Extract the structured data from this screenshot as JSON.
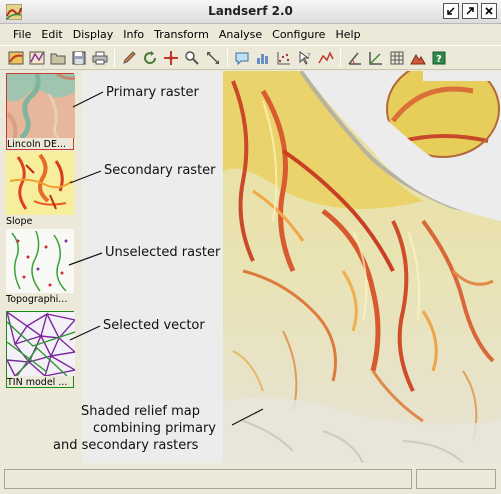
{
  "window": {
    "title": "Landserf 2.0",
    "controls": [
      "minimize",
      "maximize",
      "close"
    ]
  },
  "menu": {
    "items": [
      "File",
      "Edit",
      "Display",
      "Info",
      "Transform",
      "Analyse",
      "Configure",
      "Help"
    ]
  },
  "toolbar": {
    "groups": [
      [
        "raster-icon",
        "vector-icon",
        "open-folder-icon",
        "save-icon",
        "print-icon"
      ],
      [
        "pencil-icon",
        "refresh-icon",
        "crosshair-icon",
        "zoom-icon",
        "pan-icon"
      ],
      [
        "info-bubble-icon",
        "histogram-icon",
        "scatter-icon",
        "query-icon",
        "profile-icon"
      ],
      [
        "angle-icon",
        "axes-icon",
        "grid-icon",
        "terrain-icon",
        "help-icon"
      ]
    ]
  },
  "thumbnails": [
    {
      "label": "Lincoln DE...",
      "kind": "primary"
    },
    {
      "label": "Slope",
      "kind": "secondary"
    },
    {
      "label": "Topographi...",
      "kind": "unselected"
    },
    {
      "label": "TIN model ...",
      "kind": "vector"
    }
  ],
  "annotations": {
    "primary": "Primary raster",
    "secondary": "Secondary raster",
    "unselected": "Unselected raster",
    "vector": "Selected vector",
    "relief_line1": "Shaded relief map",
    "relief_line2": "combining primary",
    "relief_line3": "and secondary rasters"
  },
  "colors": {
    "primary_border": "#c83a3a",
    "vector_border": "#1a8a1a",
    "map_background": "#ececec"
  }
}
